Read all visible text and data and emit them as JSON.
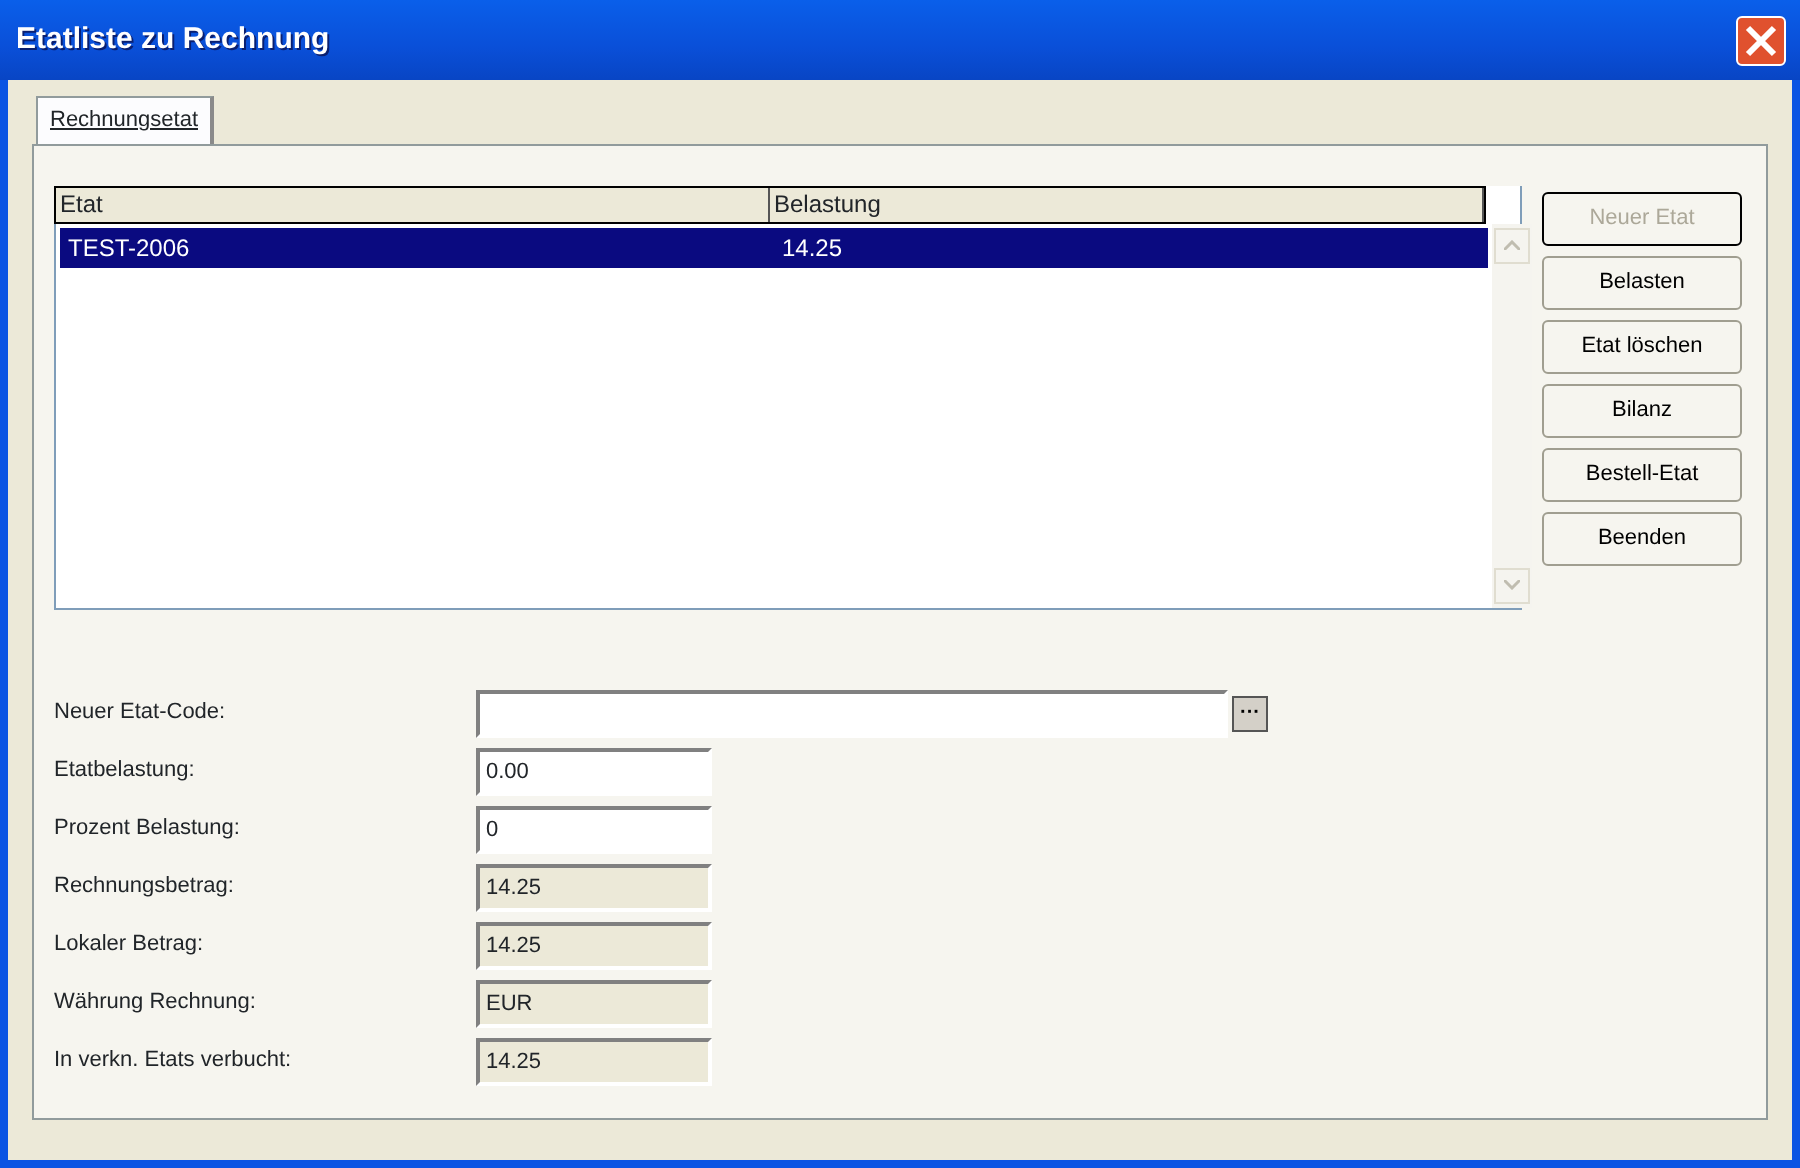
{
  "window": {
    "title": "Etatliste zu Rechnung"
  },
  "tabs": [
    {
      "label": "Rechnungsetat",
      "selected": true
    }
  ],
  "table": {
    "columns": [
      "Etat",
      "Belastung"
    ],
    "rows": [
      {
        "cells": [
          "TEST-2006",
          "14.25"
        ],
        "selected": true
      }
    ]
  },
  "buttons": [
    {
      "label": "Neuer Etat",
      "disabled": true,
      "default": true
    },
    {
      "label": "Belasten",
      "disabled": false,
      "default": false
    },
    {
      "label": "Etat löschen",
      "disabled": false,
      "default": false
    },
    {
      "label": "Bilanz",
      "disabled": false,
      "default": false
    },
    {
      "label": "Bestell-Etat",
      "disabled": false,
      "default": false
    },
    {
      "label": "Beenden",
      "disabled": false,
      "default": false
    }
  ],
  "fields": [
    {
      "label": "Neuer Etat-Code:",
      "kind": "lookup",
      "browse": "···"
    },
    {
      "label": "Etatbelastung:",
      "kind": "edit",
      "value": "0.00"
    },
    {
      "label": "Prozent Belastung:",
      "kind": "edit",
      "value": "0"
    },
    {
      "label": "Rechnungsbetrag:",
      "kind": "readonly",
      "value": "14.25"
    },
    {
      "label": "Lokaler Betrag:",
      "kind": "readonly",
      "value": "14.25"
    },
    {
      "label": "Währung Rechnung:",
      "kind": "readonly",
      "value": "EUR"
    },
    {
      "label": "In verkn. Etats verbucht:",
      "kind": "readonly",
      "value": "14.25"
    }
  ]
}
